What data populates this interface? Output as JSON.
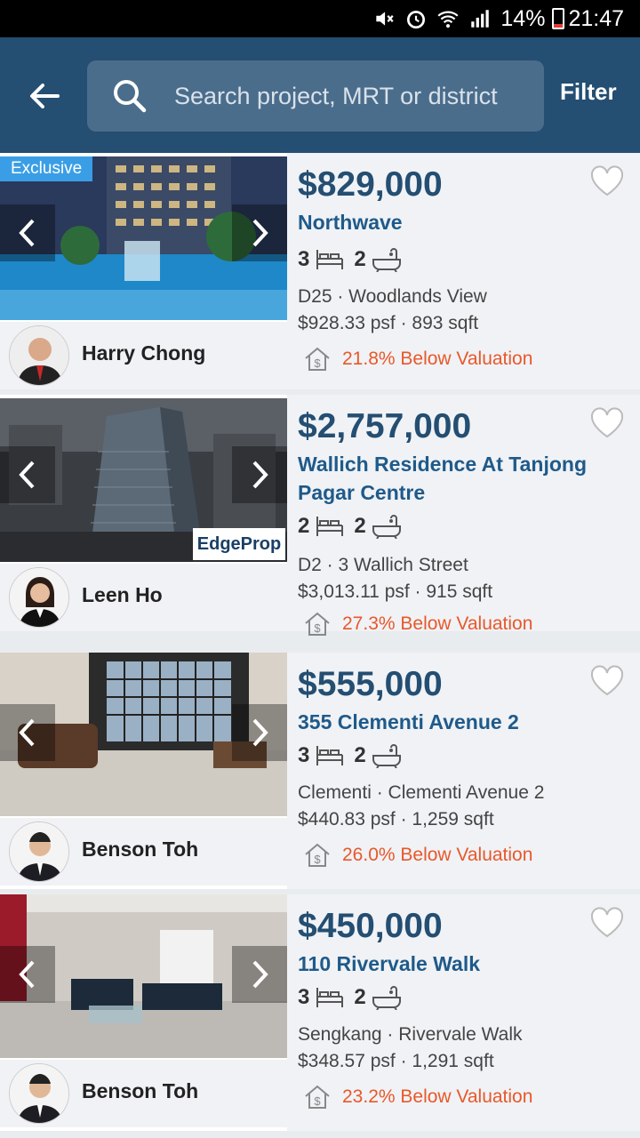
{
  "status": {
    "battery": "14%",
    "time": "21:47"
  },
  "header": {
    "search_placeholder": "Search project, MRT or district",
    "filter_label": "Filter"
  },
  "listings": [
    {
      "badge": "Exclusive",
      "price": "$829,000",
      "name": "Northwave",
      "beds": "3",
      "baths": "2",
      "location": "D25 · Woodlands View",
      "psf": "$928.33 psf · 893 sqft",
      "valuation": "21.8% Below Valuation",
      "agent": "Harry Chong"
    },
    {
      "price": "$2,757,000",
      "name": "Wallich Residence At Tanjong Pagar Centre",
      "beds": "2",
      "baths": "2",
      "location": "D2 · 3 Wallich Street",
      "psf": "$3,013.11 psf · 915 sqft",
      "valuation": "27.3% Below Valuation",
      "agent": "Leen Ho",
      "watermark": "EdgeProp"
    },
    {
      "price": "$555,000",
      "name": "355 Clementi Avenue 2",
      "beds": "3",
      "baths": "2",
      "location": "Clementi · Clementi Avenue 2",
      "psf": "$440.83 psf · 1,259 sqft",
      "valuation": "26.0% Below Valuation",
      "agent": "Benson Toh"
    },
    {
      "price": "$450,000",
      "name": "110 Rivervale Walk",
      "beds": "3",
      "baths": "2",
      "location": "Sengkang · Rivervale Walk",
      "psf": "$348.57 psf · 1,291 sqft",
      "valuation": "23.2% Below Valuation",
      "agent": "Benson Toh"
    }
  ],
  "colors": {
    "header": "#244e72",
    "price": "#244e72",
    "valuation": "#e8582a",
    "badge": "#3a9ee6"
  }
}
